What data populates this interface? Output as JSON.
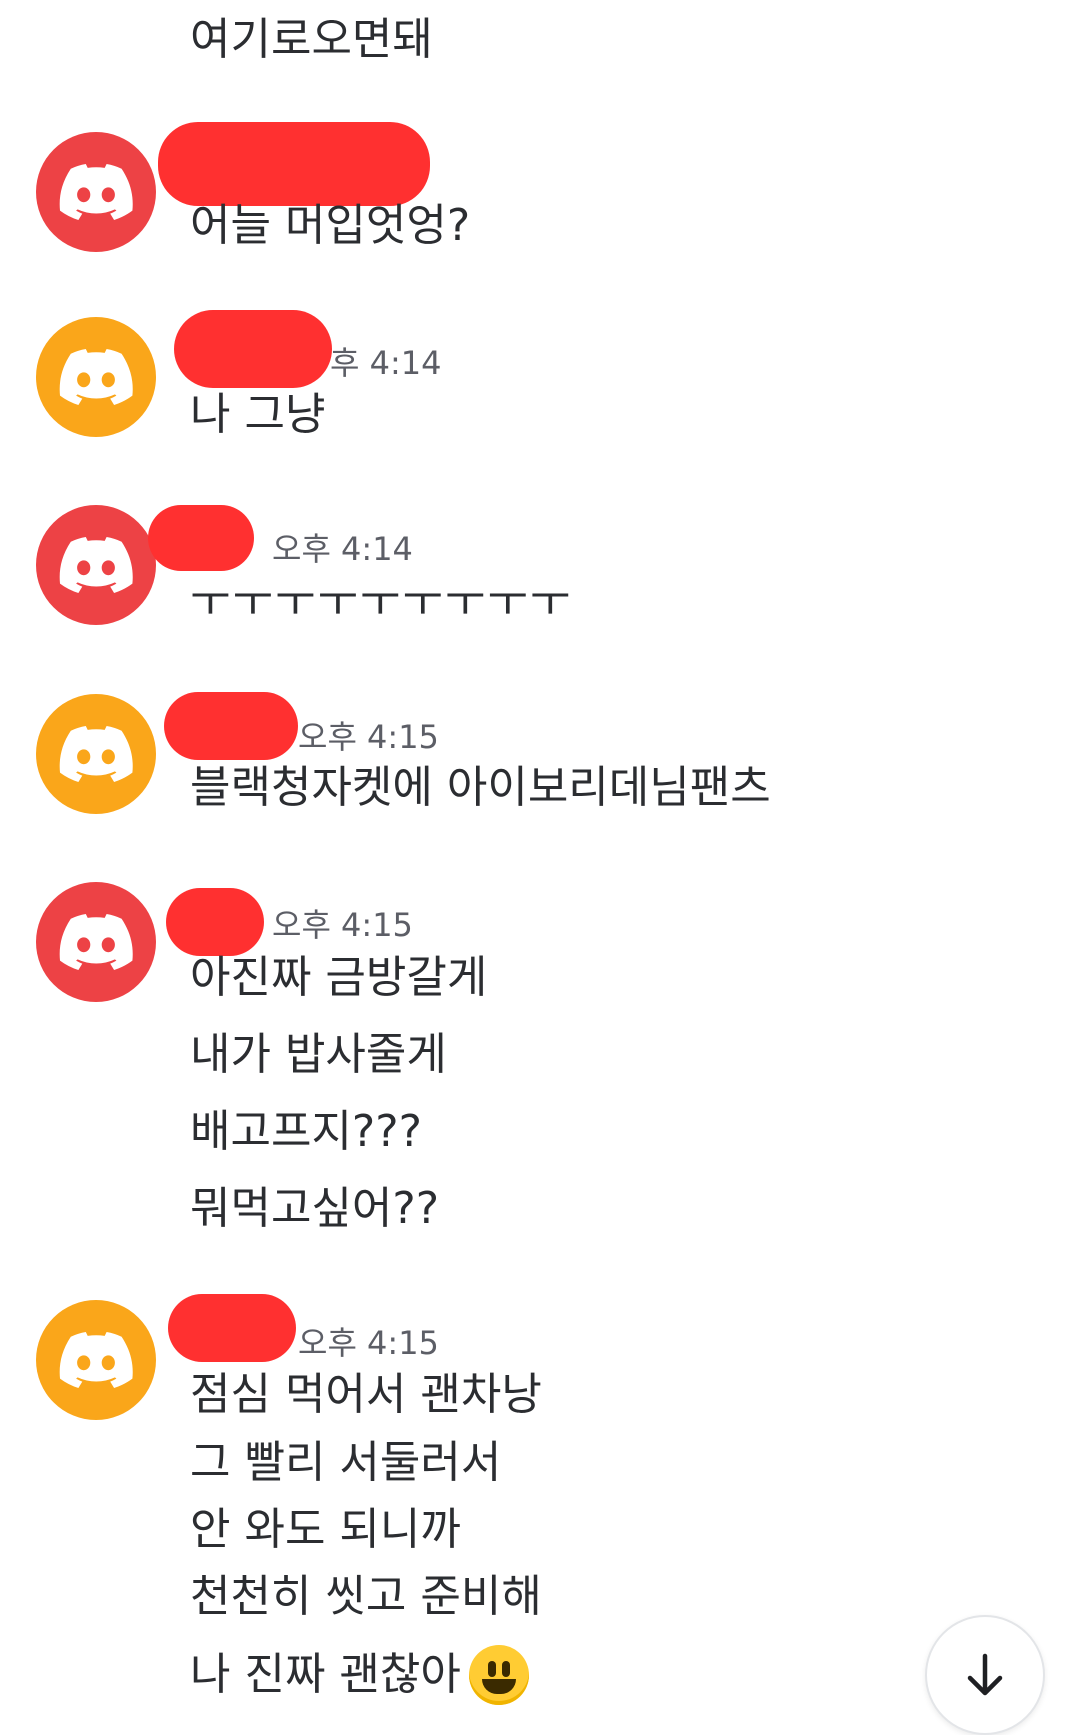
{
  "colors": {
    "red_avatar": "#ed4245",
    "orange_avatar": "#faa61a",
    "redaction": "#ff3030"
  },
  "messages": [
    {
      "avatar": "none",
      "lines": [
        "여기로오면돼"
      ]
    },
    {
      "avatar": "red",
      "timestamp": "",
      "lines": [
        "어늘 머입엇엉?"
      ]
    },
    {
      "avatar": "orange",
      "timestamp": "후 4:14",
      "lines": [
        "나 그냥"
      ]
    },
    {
      "avatar": "red",
      "timestamp": "오후 4:14",
      "lines": [
        "ㅜㅜㅜㅜㅜㅜㅜㅜㅜ"
      ]
    },
    {
      "avatar": "orange",
      "timestamp": "오후 4:15",
      "lines": [
        "블랙청자켓에 아이보리데님팬츠"
      ]
    },
    {
      "avatar": "red",
      "timestamp": "오후 4:15",
      "lines": [
        "아진짜 금방갈게",
        "내가 밥사줄게",
        "배고프지???",
        "뭐먹고싶어??"
      ]
    },
    {
      "avatar": "orange",
      "timestamp": "오후 4:15",
      "lines": [
        "점심 먹어서 괜차낭",
        "그 빨리 서둘러서",
        "안 와도 되니까",
        "천천히 씻고 준비해",
        "나 진짜 괜찮아"
      ]
    }
  ],
  "icons": {
    "avatar": "discord-logo-icon",
    "scroll": "arrow-down-icon",
    "emoji": "smiley-emoji-icon"
  }
}
